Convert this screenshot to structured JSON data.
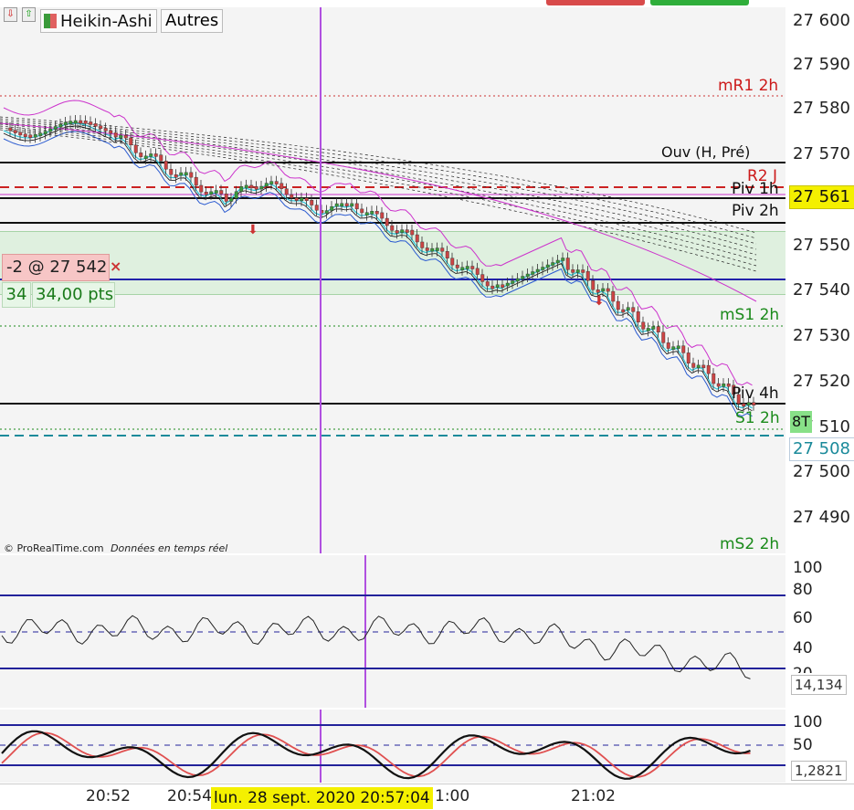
{
  "toolbar": {
    "chart_type_label": "Heikin-Ashi",
    "others_label": "Autres",
    "down_arrow_icon": "red-down-arrow-icon",
    "up_arrow_icon": "green-up-arrow-icon"
  },
  "price_axis": {
    "ticks": [
      "27 600",
      "27 590",
      "27 580",
      "27 570",
      "27 561",
      "27 550",
      "27 540",
      "27 530",
      "27 520",
      "27 510",
      "27 500",
      "27 490"
    ],
    "current_price_label": "27 561",
    "order_price_label": "27 508",
    "tick_label_8T": "8T"
  },
  "levels": {
    "mr1": "mR1 2h",
    "ouv": "Ouv (H, Pré)",
    "r2j": "R2 J",
    "piv1h": "Piv 1h",
    "piv2h": "Piv 2h",
    "ms1": "mS1 2h",
    "piv4h": "Piv 4h",
    "s12h": "S1 2h",
    "ms2": "mS2 2h"
  },
  "position": {
    "label": "-2 @ 27 542",
    "qty": "34",
    "pts": "34,00 pts",
    "close_icon": "close-icon"
  },
  "credits": {
    "source": "© ProRealTime.com",
    "realtime": "Données en temps réel"
  },
  "rsi": {
    "ticks": [
      "100",
      "80",
      "60",
      "40",
      "20"
    ],
    "value": "14,134"
  },
  "stoch": {
    "ticks": [
      "100",
      "50"
    ],
    "value": "1,2821"
  },
  "time_axis": {
    "labels": [
      "20:52",
      "20:54",
      "1:00",
      "21:02"
    ],
    "cursor_label": "lun. 28 sept. 2020 20:57:04"
  },
  "colors": {
    "bull": "#3a9a3a",
    "bear": "#cc4444",
    "cursor": "#b050e0",
    "navy": "#22229a"
  }
}
